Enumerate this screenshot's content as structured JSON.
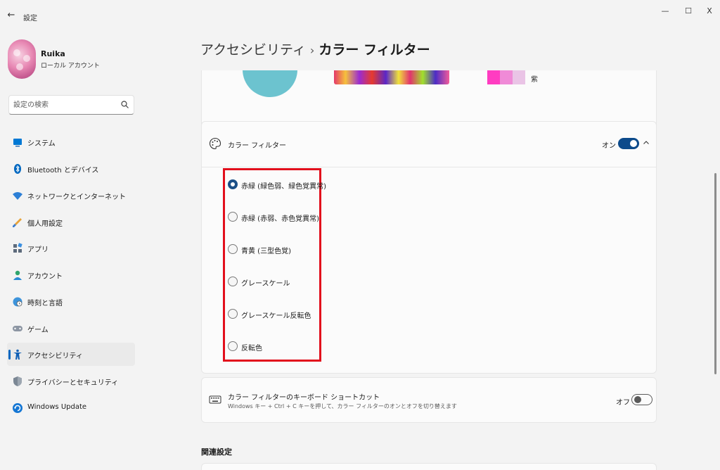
{
  "window": {
    "title": "設定",
    "back_glyph": "←",
    "minimize_glyph": "—",
    "maximize_glyph": "☐",
    "close_glyph": "X"
  },
  "user": {
    "name": "Ruika",
    "account_type": "ローカル アカウント"
  },
  "search": {
    "placeholder": "設定の検索"
  },
  "sidebar": {
    "items": [
      {
        "label": "システム",
        "icon": "system-icon"
      },
      {
        "label": "Bluetooth とデバイス",
        "icon": "bluetooth-icon"
      },
      {
        "label": "ネットワークとインターネット",
        "icon": "wifi-icon"
      },
      {
        "label": "個人用設定",
        "icon": "brush-icon"
      },
      {
        "label": "アプリ",
        "icon": "apps-icon"
      },
      {
        "label": "アカウント",
        "icon": "account-icon"
      },
      {
        "label": "時刻と言語",
        "icon": "globe-clock-icon"
      },
      {
        "label": "ゲーム",
        "icon": "gamepad-icon"
      },
      {
        "label": "アクセシビリティ",
        "icon": "accessibility-icon",
        "selected": true
      },
      {
        "label": "プライバシーとセキュリティ",
        "icon": "shield-icon"
      },
      {
        "label": "Windows Update",
        "icon": "update-icon"
      }
    ]
  },
  "breadcrumb": {
    "parent": "アクセシビリティ",
    "separator": "›",
    "current": "カラー フィルター"
  },
  "preview": {
    "swatch_label": "紫"
  },
  "color_filter": {
    "title": "カラー フィルター",
    "toggle_label": "オン",
    "toggle_on": true,
    "options": [
      {
        "label": "赤緑 (緑色弱、緑色覚異常)",
        "checked": true
      },
      {
        "label": "赤緑 (赤弱、赤色覚異常)",
        "checked": false
      },
      {
        "label": "青黄 (三型色覚)",
        "checked": false
      },
      {
        "label": "グレースケール",
        "checked": false
      },
      {
        "label": "グレースケール反転色",
        "checked": false
      },
      {
        "label": "反転色",
        "checked": false
      }
    ]
  },
  "shortcut": {
    "title": "カラー フィルターのキーボード ショートカット",
    "description": "Windows キー + Ctrl + C キーを押して、カラー フィルターのオンとオフを切り替えます",
    "toggle_label": "オフ",
    "toggle_on": false
  },
  "related": {
    "heading": "関連設定"
  },
  "colors": {
    "accent": "#0067c0",
    "toggle_on": "#0c4a8b",
    "highlight_box": "#e20f1c"
  }
}
